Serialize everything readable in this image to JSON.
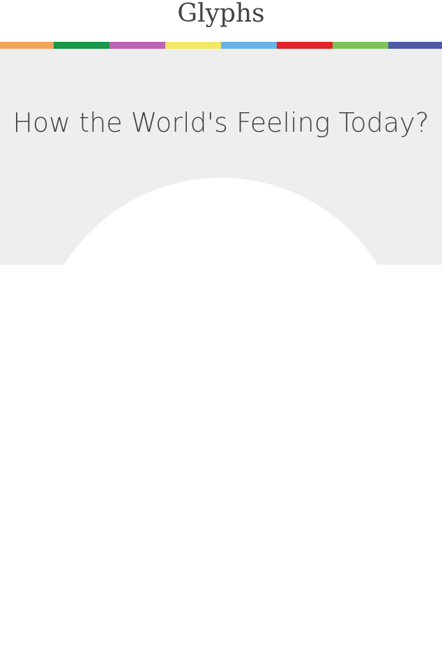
{
  "header": {
    "logo_text": "Glyphs"
  },
  "color_stripe": [
    "#f2a35a",
    "#19974a",
    "#bf63b4",
    "#f1e866",
    "#69b3e5",
    "#e22329",
    "#7ec35a",
    "#4f5aa5"
  ],
  "hero": {
    "title": "How the World's Feeling Today?",
    "background_color": "#eeeeee"
  }
}
